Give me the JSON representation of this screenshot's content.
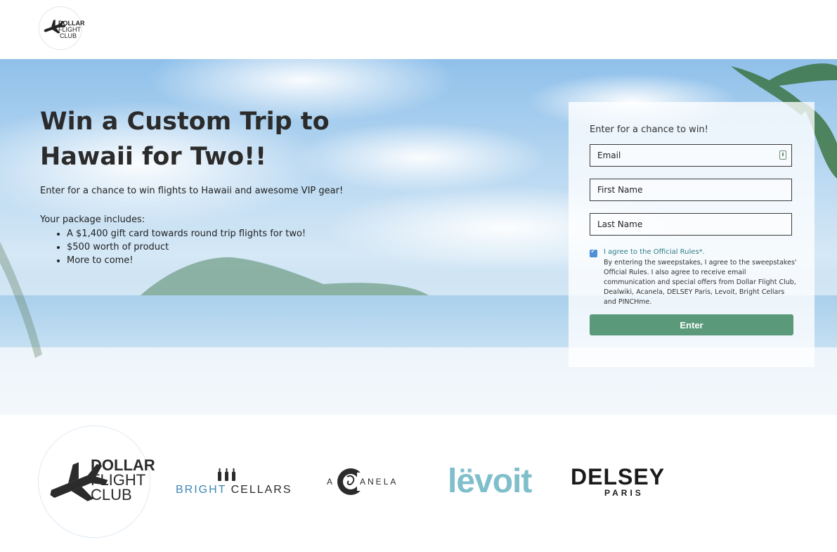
{
  "header": {
    "logo": {
      "line1": "DOLLAR",
      "line2": "FLIGHT",
      "line3": "CLUB"
    }
  },
  "hero": {
    "title": "Win a Custom Trip to Hawaii for Two!!",
    "subtitle": "Enter for a chance to win flights to Hawaii and awesome VIP gear!",
    "package_heading": "Your package includes:",
    "package_items": [
      "A $1,400 gift card towards round trip flights for two!",
      "$500 worth of product",
      "More to come!"
    ]
  },
  "form": {
    "heading": "Enter for a chance to win!",
    "email_placeholder": "Email",
    "first_name_placeholder": "First Name",
    "last_name_placeholder": "Last Name",
    "agree_text": "I agree to the Official Rules*.",
    "consent_text": "By entering the sweepstakes, I agree to the sweepstakes' Official Rules. I also agree to receive email communication and special offers from Dollar Flight Club, Dealwiki, Acanela, DELSEY Paris, Levoit, Bright Cellars and PINCHme.",
    "checkbox_checked": true,
    "submit_label": "Enter",
    "submit_color": "#5a9a7a"
  },
  "partners": {
    "dollar_flight_club": {
      "line1": "DOLLAR",
      "line2": "FLIGHT",
      "line3": "CLUB"
    },
    "bright_cellars": {
      "bright": "BRIGHT",
      "cellars": "CELLARS"
    },
    "acanela": {
      "a": "A",
      "rest": "ANELA"
    },
    "levoit": "lëvoit",
    "delsey": {
      "name": "DELSEY",
      "city": "PARIS"
    }
  }
}
